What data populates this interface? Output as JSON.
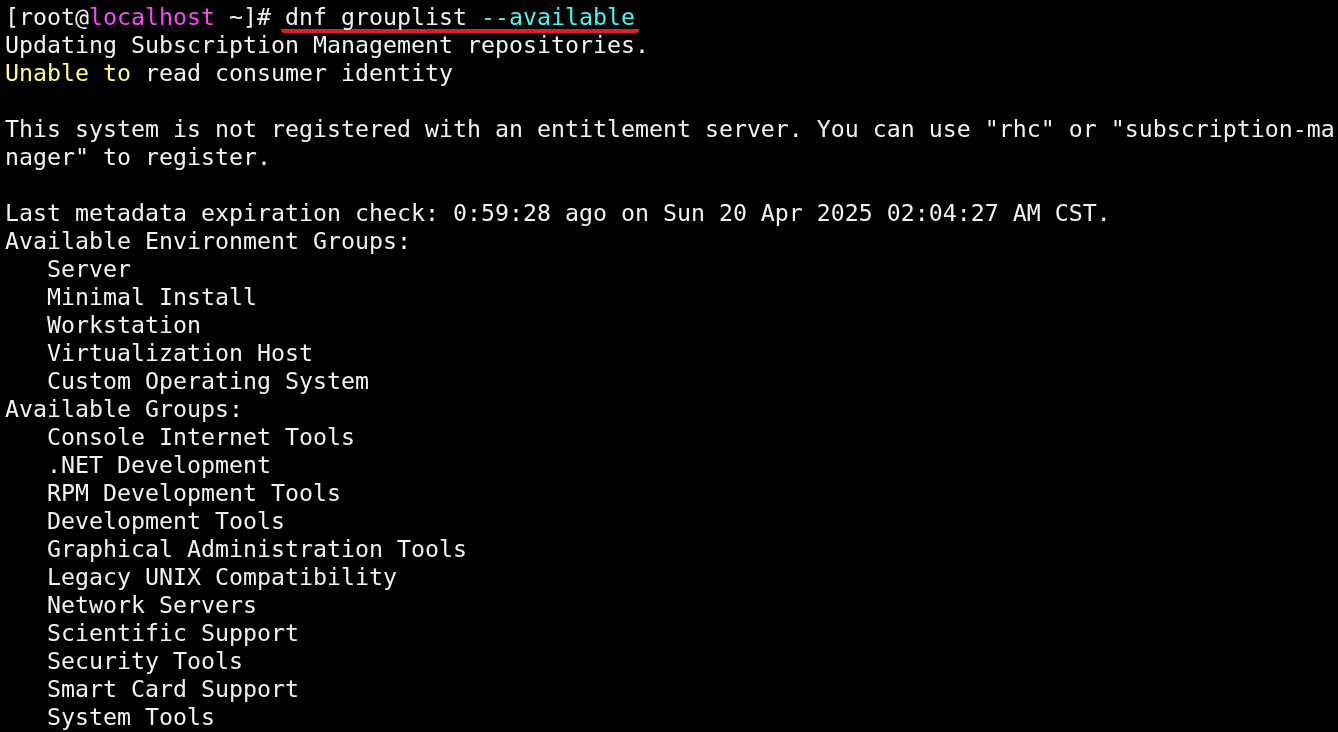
{
  "lines": [
    {
      "kind": "prompt",
      "user_part": "[root@",
      "host": "localhost",
      "path_part": "~]#",
      "command": "dnf grouplist",
      "option": "--available",
      "underlined": true
    },
    {
      "kind": "text",
      "segments": [
        {
          "text": "Updating Subscription Management repositories.",
          "color": "#f2f2f2"
        }
      ]
    },
    {
      "kind": "text",
      "segments": [
        {
          "text": "Unable to",
          "color": "#ffff80"
        },
        {
          "text": "read consumer identity",
          "color": "#f2f2f2"
        }
      ]
    },
    {
      "kind": "blank"
    },
    {
      "kind": "text",
      "segments": [
        {
          "text": "This system is not registered with an entitlement server. You can use \"rhc\" or \"subscription-ma",
          "color": "#f2f2f2"
        }
      ]
    },
    {
      "kind": "text",
      "segments": [
        {
          "text": "nager\" to register.",
          "color": "#f2f2f2"
        }
      ]
    },
    {
      "kind": "blank"
    },
    {
      "kind": "text",
      "segments": [
        {
          "text": "Last metadata expiration check: 0:59:28 ago on Sun 20 Apr 2025 02:04:27 AM CST.",
          "color": "#f2f2f2"
        }
      ]
    },
    {
      "kind": "group",
      "title": "Available Environment Groups:",
      "children": [
        {
          "text": "Server"
        },
        {
          "text": "Minimal Install"
        },
        {
          "text": "Workstation"
        },
        {
          "text": "Virtualization Host"
        },
        {
          "text": "Custom Operating System"
        }
      ]
    },
    {
      "kind": "group",
      "title": "Available Groups:",
      "children": [
        {
          "text": "Console Internet Tools"
        },
        {
          "text": ".NET Development"
        },
        {
          "text": "RPM Development Tools"
        },
        {
          "text": "Development Tools"
        },
        {
          "text": "Graphical Administration Tools"
        },
        {
          "text": "Legacy UNIX Compatibility"
        },
        {
          "text": "Network Servers"
        },
        {
          "text": "Scientific Support"
        },
        {
          "text": "Security Tools"
        },
        {
          "text": "Smart Card Support"
        },
        {
          "text": "System Tools"
        }
      ]
    }
  ]
}
